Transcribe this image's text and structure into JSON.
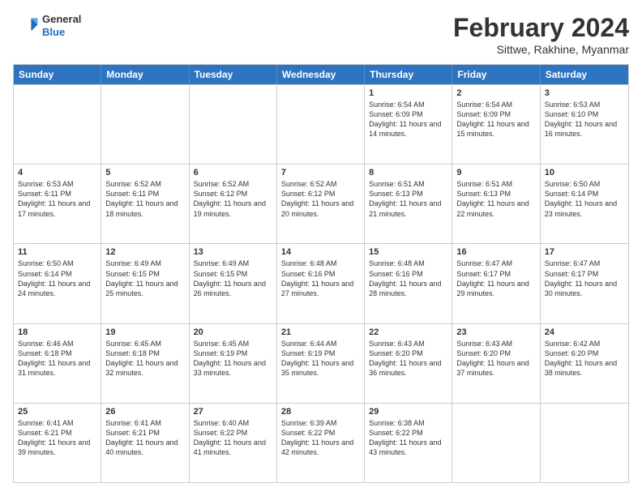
{
  "header": {
    "logo": {
      "general": "General",
      "blue": "Blue"
    },
    "title": "February 2024",
    "subtitle": "Sittwe, Rakhine, Myanmar"
  },
  "weekdays": [
    "Sunday",
    "Monday",
    "Tuesday",
    "Wednesday",
    "Thursday",
    "Friday",
    "Saturday"
  ],
  "weeks": [
    [
      {
        "day": "",
        "info": ""
      },
      {
        "day": "",
        "info": ""
      },
      {
        "day": "",
        "info": ""
      },
      {
        "day": "",
        "info": ""
      },
      {
        "day": "1",
        "info": "Sunrise: 6:54 AM\nSunset: 6:09 PM\nDaylight: 11 hours and 14 minutes."
      },
      {
        "day": "2",
        "info": "Sunrise: 6:54 AM\nSunset: 6:09 PM\nDaylight: 11 hours and 15 minutes."
      },
      {
        "day": "3",
        "info": "Sunrise: 6:53 AM\nSunset: 6:10 PM\nDaylight: 11 hours and 16 minutes."
      }
    ],
    [
      {
        "day": "4",
        "info": "Sunrise: 6:53 AM\nSunset: 6:11 PM\nDaylight: 11 hours and 17 minutes."
      },
      {
        "day": "5",
        "info": "Sunrise: 6:52 AM\nSunset: 6:11 PM\nDaylight: 11 hours and 18 minutes."
      },
      {
        "day": "6",
        "info": "Sunrise: 6:52 AM\nSunset: 6:12 PM\nDaylight: 11 hours and 19 minutes."
      },
      {
        "day": "7",
        "info": "Sunrise: 6:52 AM\nSunset: 6:12 PM\nDaylight: 11 hours and 20 minutes."
      },
      {
        "day": "8",
        "info": "Sunrise: 6:51 AM\nSunset: 6:13 PM\nDaylight: 11 hours and 21 minutes."
      },
      {
        "day": "9",
        "info": "Sunrise: 6:51 AM\nSunset: 6:13 PM\nDaylight: 11 hours and 22 minutes."
      },
      {
        "day": "10",
        "info": "Sunrise: 6:50 AM\nSunset: 6:14 PM\nDaylight: 11 hours and 23 minutes."
      }
    ],
    [
      {
        "day": "11",
        "info": "Sunrise: 6:50 AM\nSunset: 6:14 PM\nDaylight: 11 hours and 24 minutes."
      },
      {
        "day": "12",
        "info": "Sunrise: 6:49 AM\nSunset: 6:15 PM\nDaylight: 11 hours and 25 minutes."
      },
      {
        "day": "13",
        "info": "Sunrise: 6:49 AM\nSunset: 6:15 PM\nDaylight: 11 hours and 26 minutes."
      },
      {
        "day": "14",
        "info": "Sunrise: 6:48 AM\nSunset: 6:16 PM\nDaylight: 11 hours and 27 minutes."
      },
      {
        "day": "15",
        "info": "Sunrise: 6:48 AM\nSunset: 6:16 PM\nDaylight: 11 hours and 28 minutes."
      },
      {
        "day": "16",
        "info": "Sunrise: 6:47 AM\nSunset: 6:17 PM\nDaylight: 11 hours and 29 minutes."
      },
      {
        "day": "17",
        "info": "Sunrise: 6:47 AM\nSunset: 6:17 PM\nDaylight: 11 hours and 30 minutes."
      }
    ],
    [
      {
        "day": "18",
        "info": "Sunrise: 6:46 AM\nSunset: 6:18 PM\nDaylight: 11 hours and 31 minutes."
      },
      {
        "day": "19",
        "info": "Sunrise: 6:45 AM\nSunset: 6:18 PM\nDaylight: 11 hours and 32 minutes."
      },
      {
        "day": "20",
        "info": "Sunrise: 6:45 AM\nSunset: 6:19 PM\nDaylight: 11 hours and 33 minutes."
      },
      {
        "day": "21",
        "info": "Sunrise: 6:44 AM\nSunset: 6:19 PM\nDaylight: 11 hours and 35 minutes."
      },
      {
        "day": "22",
        "info": "Sunrise: 6:43 AM\nSunset: 6:20 PM\nDaylight: 11 hours and 36 minutes."
      },
      {
        "day": "23",
        "info": "Sunrise: 6:43 AM\nSunset: 6:20 PM\nDaylight: 11 hours and 37 minutes."
      },
      {
        "day": "24",
        "info": "Sunrise: 6:42 AM\nSunset: 6:20 PM\nDaylight: 11 hours and 38 minutes."
      }
    ],
    [
      {
        "day": "25",
        "info": "Sunrise: 6:41 AM\nSunset: 6:21 PM\nDaylight: 11 hours and 39 minutes."
      },
      {
        "day": "26",
        "info": "Sunrise: 6:41 AM\nSunset: 6:21 PM\nDaylight: 11 hours and 40 minutes."
      },
      {
        "day": "27",
        "info": "Sunrise: 6:40 AM\nSunset: 6:22 PM\nDaylight: 11 hours and 41 minutes."
      },
      {
        "day": "28",
        "info": "Sunrise: 6:39 AM\nSunset: 6:22 PM\nDaylight: 11 hours and 42 minutes."
      },
      {
        "day": "29",
        "info": "Sunrise: 6:38 AM\nSunset: 6:22 PM\nDaylight: 11 hours and 43 minutes."
      },
      {
        "day": "",
        "info": ""
      },
      {
        "day": "",
        "info": ""
      }
    ]
  ]
}
